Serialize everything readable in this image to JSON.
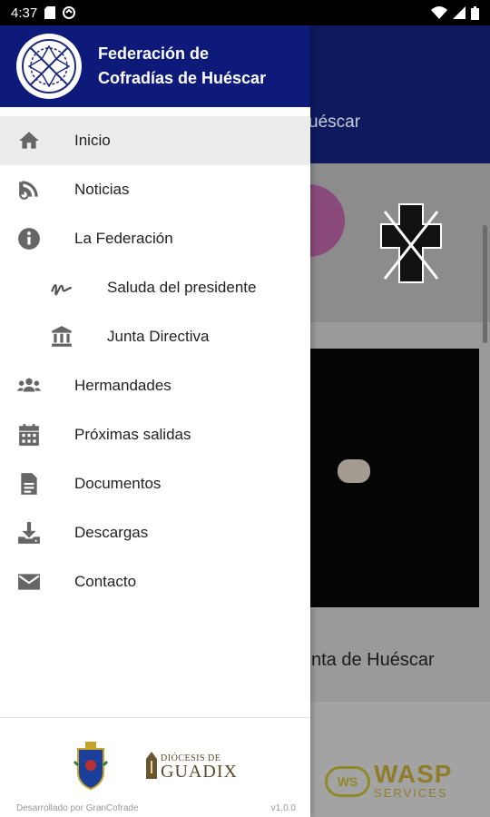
{
  "status_bar": {
    "time": "4:37",
    "icons": [
      "sd-card-icon",
      "sync-icon",
      "wifi-icon",
      "signal-icon",
      "battery-icon"
    ]
  },
  "background": {
    "app_bar_title": "uéscar",
    "card_caption": "nta de Huéscar",
    "sponsor": {
      "ws": "WS",
      "name": "WASP",
      "tagline": "SERVICES"
    }
  },
  "drawer": {
    "header_title": "Federación de Cofradías de Huéscar",
    "items": [
      {
        "label": "Inicio",
        "icon": "home-icon",
        "active": true
      },
      {
        "label": "Noticias",
        "icon": "rss-icon"
      },
      {
        "label": "La Federación",
        "icon": "info-icon"
      },
      {
        "label": "Saluda del presidente",
        "icon": "signature-icon",
        "sub": true
      },
      {
        "label": "Junta Directiva",
        "icon": "institution-icon",
        "sub": true
      },
      {
        "label": "Hermandades",
        "icon": "users-icon"
      },
      {
        "label": "Próximas salidas",
        "icon": "calendar-icon"
      },
      {
        "label": "Documentos",
        "icon": "document-icon"
      },
      {
        "label": "Descargas",
        "icon": "download-icon"
      },
      {
        "label": "Contacto",
        "icon": "mail-icon"
      }
    ],
    "footer": {
      "guadix_line1": "DIÓCESIS DE",
      "guadix_line2": "GUADIX",
      "developer": "Desarrollado por GranCofrade",
      "version": "v1.0.0"
    }
  },
  "colors": {
    "header_blue": "#0d1a7a",
    "app_bar_blue": "#0d1a5e",
    "active_item_bg": "#ececec",
    "icon_gray": "#666666"
  }
}
